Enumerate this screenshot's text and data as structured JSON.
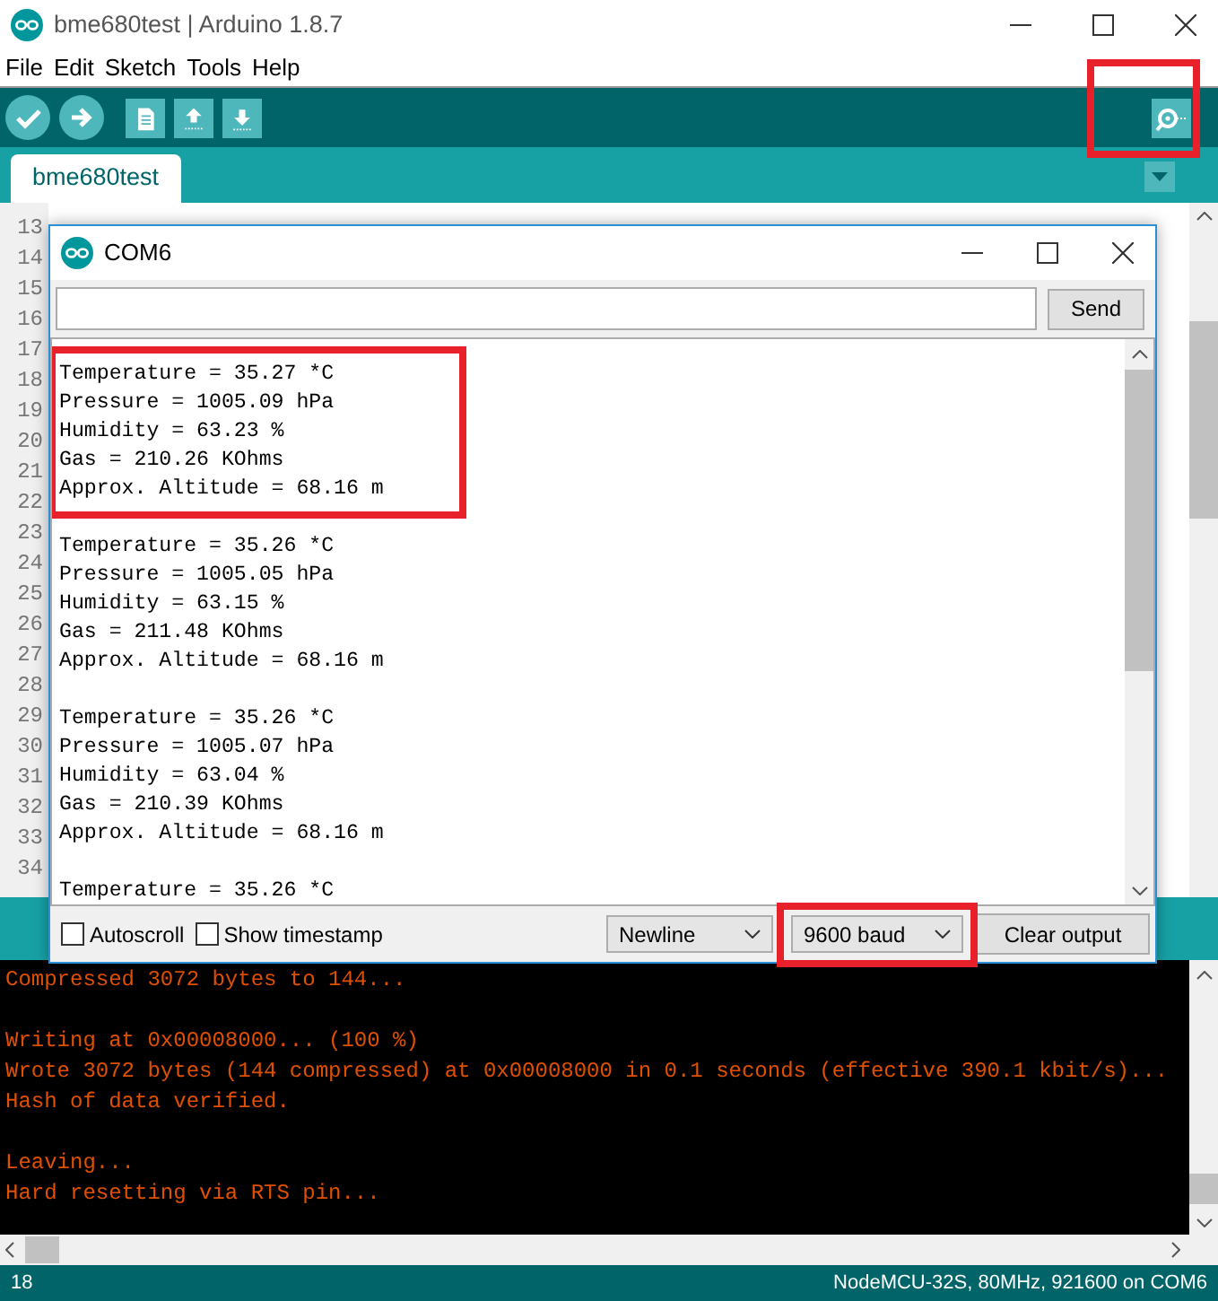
{
  "window": {
    "title": "bme680test | Arduino 1.8.7"
  },
  "menu": [
    "File",
    "Edit",
    "Sketch",
    "Tools",
    "Help"
  ],
  "toolbar": {
    "buttons": [
      {
        "kind": "verify"
      },
      {
        "kind": "upload"
      },
      {
        "kind": "new"
      },
      {
        "kind": "open"
      },
      {
        "kind": "save"
      }
    ],
    "serial_monitor": {
      "highlighted": true
    }
  },
  "tabs": [
    {
      "label": "bme680test",
      "selected": true
    }
  ],
  "editor": {
    "line_numbers": [
      "13",
      "14",
      "15",
      "16",
      "17",
      "18",
      "19",
      "20",
      "21",
      "22",
      "23",
      "24",
      "25",
      "26",
      "27",
      "28",
      "29",
      "30",
      "31",
      "32",
      "33",
      "34"
    ]
  },
  "serial_monitor": {
    "title": "COM6",
    "send_button": "Send",
    "output": [
      {
        "highlighted": true,
        "lines": [
          "Temperature = 35.27 *C",
          "Pressure = 1005.09 hPa",
          "Humidity = 63.23 %",
          "Gas = 210.26 KOhms",
          "Approx. Altitude = 68.16 m"
        ]
      },
      {
        "highlighted": false,
        "lines": [
          "Temperature = 35.26 *C",
          "Pressure = 1005.05 hPa",
          "Humidity = 63.15 %",
          "Gas = 211.48 KOhms",
          "Approx. Altitude = 68.16 m"
        ]
      },
      {
        "highlighted": false,
        "lines": [
          "Temperature = 35.26 *C",
          "Pressure = 1005.07 hPa",
          "Humidity = 63.04 %",
          "Gas = 210.39 KOhms",
          "Approx. Altitude = 68.16 m"
        ]
      },
      {
        "highlighted": false,
        "lines": [
          "Temperature = 35.26 *C"
        ]
      }
    ],
    "autoscroll": {
      "label": "Autoscroll",
      "checked": false
    },
    "timestamp": {
      "label": "Show timestamp",
      "checked": false
    },
    "line_ending": {
      "value": "Newline"
    },
    "baud_rate": {
      "value": "9600 baud",
      "highlighted": true
    },
    "clear_button": "Clear output"
  },
  "console": [
    [
      "Compressed 3072 bytes to 144..."
    ],
    [
      "Writing at 0x00008000... (100 %)",
      "Wrote 3072 bytes (144 compressed) at 0x00008000 in 0.1 seconds (effective 390.1 kbit/s)...",
      "Hash of data verified."
    ],
    [
      "Leaving...",
      "Hard resetting via RTS pin..."
    ]
  ],
  "status_bar": {
    "line": "18",
    "board": "NodeMCU-32S, 80MHz, 921600 on COM6"
  }
}
